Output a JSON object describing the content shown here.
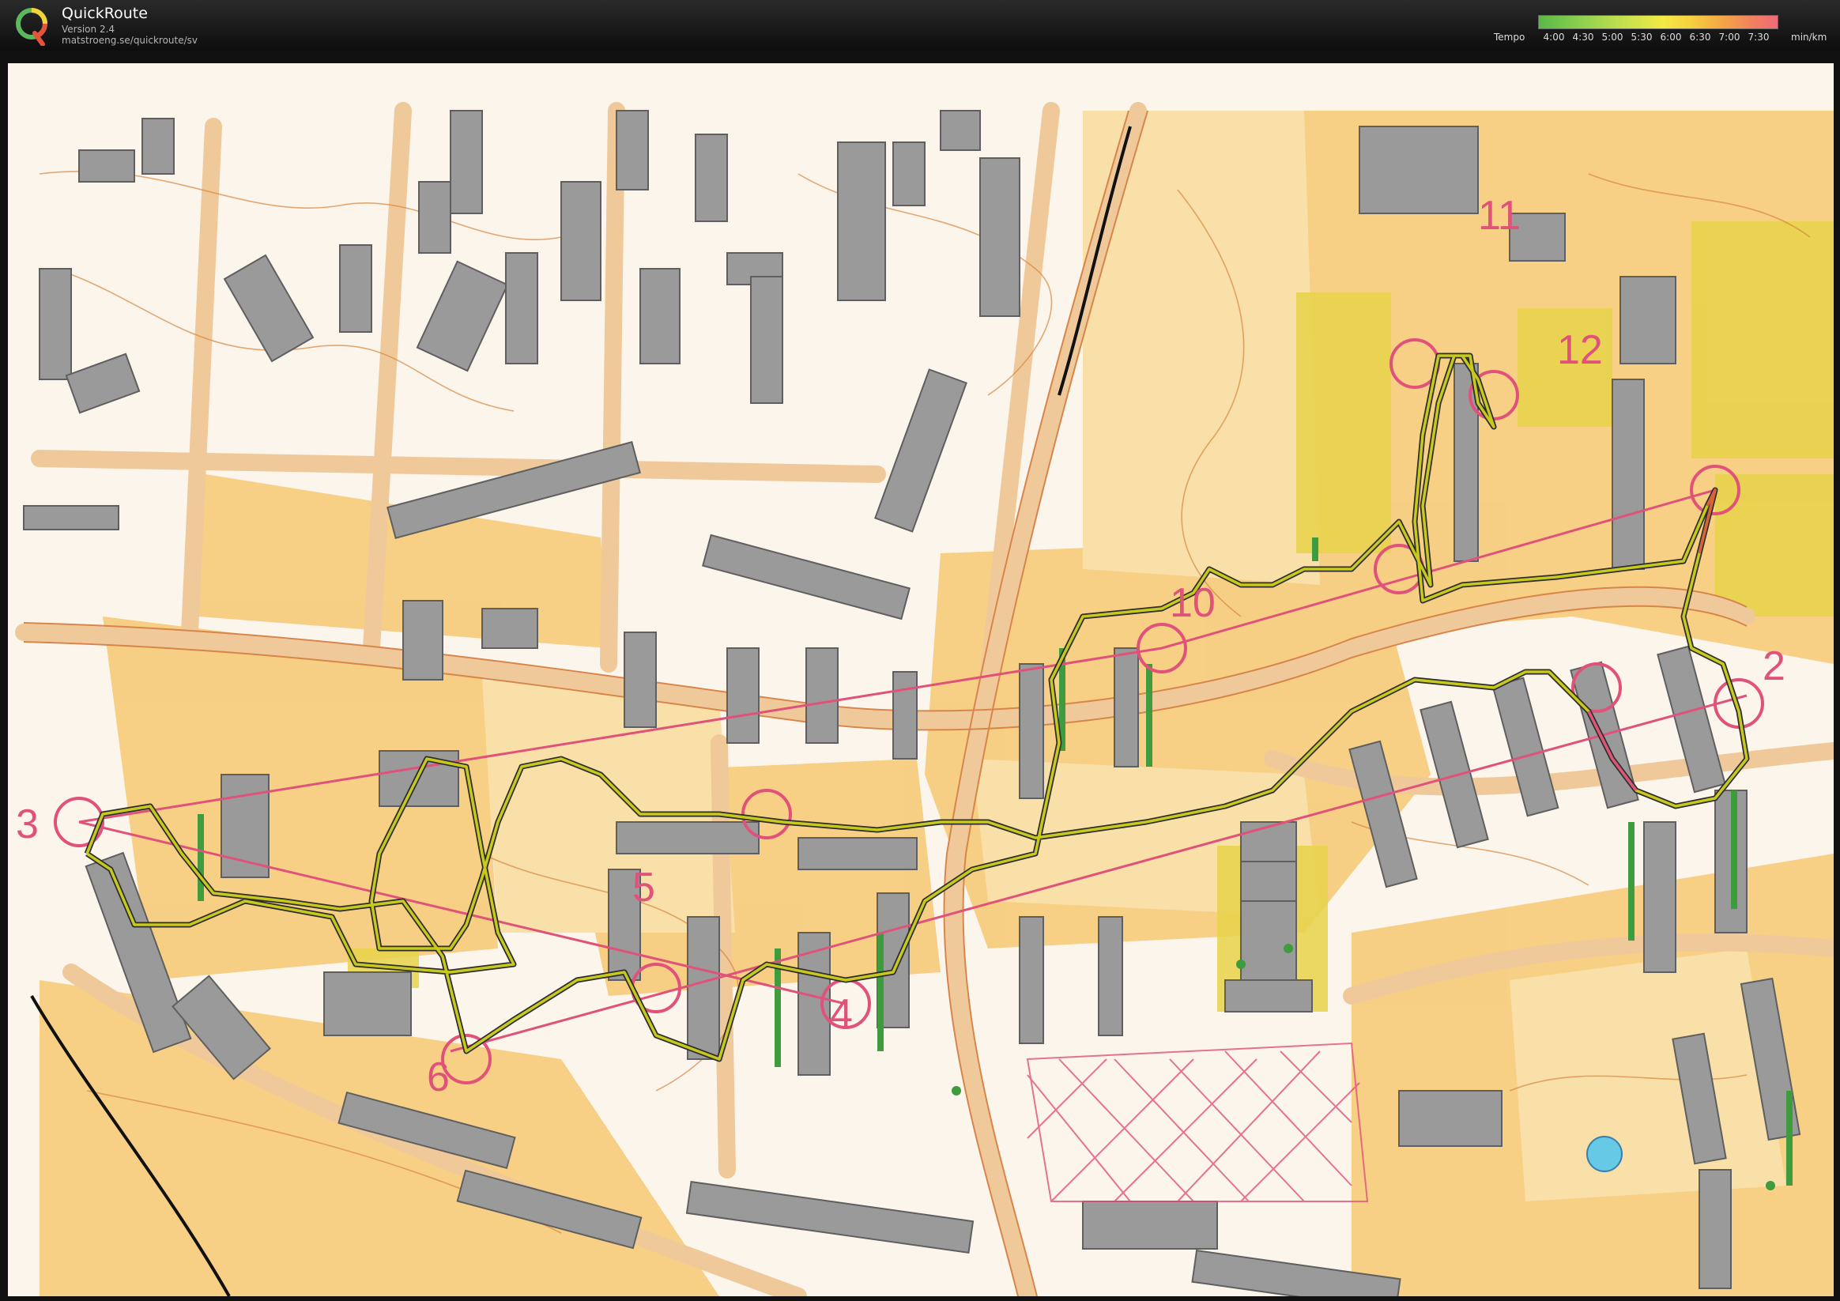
{
  "app": {
    "name": "QuickRoute",
    "version": "Version 2.4",
    "url": "matstroeng.se/quickroute/sv",
    "logo_letter": "Q"
  },
  "legend": {
    "tempo_label": "Tempo",
    "unit_label": "min/km",
    "ticks": [
      "4:00",
      "4:30",
      "5:00",
      "5:30",
      "6:00",
      "6:30",
      "7:00",
      "7:30"
    ]
  },
  "map": {
    "control_numbers": [
      "2",
      "3",
      "4",
      "5",
      "6",
      "10",
      "11",
      "12"
    ],
    "colors": {
      "paper": "#fbf5ec",
      "open_land": "#f6c873",
      "rough_open": "#f9dfa8",
      "road": "#f0c99a",
      "contour": "#d9863e",
      "building": "#9a9a9a",
      "vegetation": "#3e9c3e",
      "course": "#e0527a",
      "route": "#c7c91d"
    }
  }
}
